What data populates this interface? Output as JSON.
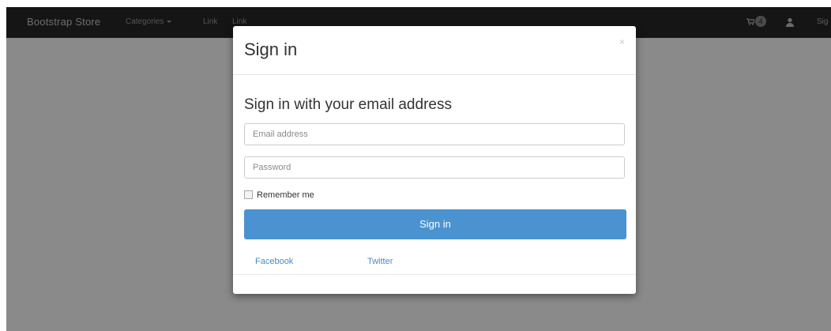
{
  "navbar": {
    "brand": "Bootstrap Store",
    "links": [
      {
        "label": "Categories"
      },
      {
        "label": "Link"
      },
      {
        "label": "Link"
      }
    ],
    "cart_badge": "4",
    "signin_label": "Sig",
    "icons": [
      "cart-icon",
      "user-icon",
      "caret-down-icon"
    ]
  },
  "modal": {
    "title": "Sign in",
    "close_label": "×",
    "subheading": "Sign in with your email address",
    "email_placeholder": "Email address",
    "password_placeholder": "Password",
    "remember_label": "Remember me",
    "submit_label": "Sign in",
    "social": {
      "facebook": "Facebook",
      "twitter": "Twitter"
    }
  },
  "colors": {
    "navbar_bg": "#151515",
    "overlay_bg": "#8a8a8a",
    "primary": "#4a93d0",
    "link": "#4a8ac6"
  }
}
